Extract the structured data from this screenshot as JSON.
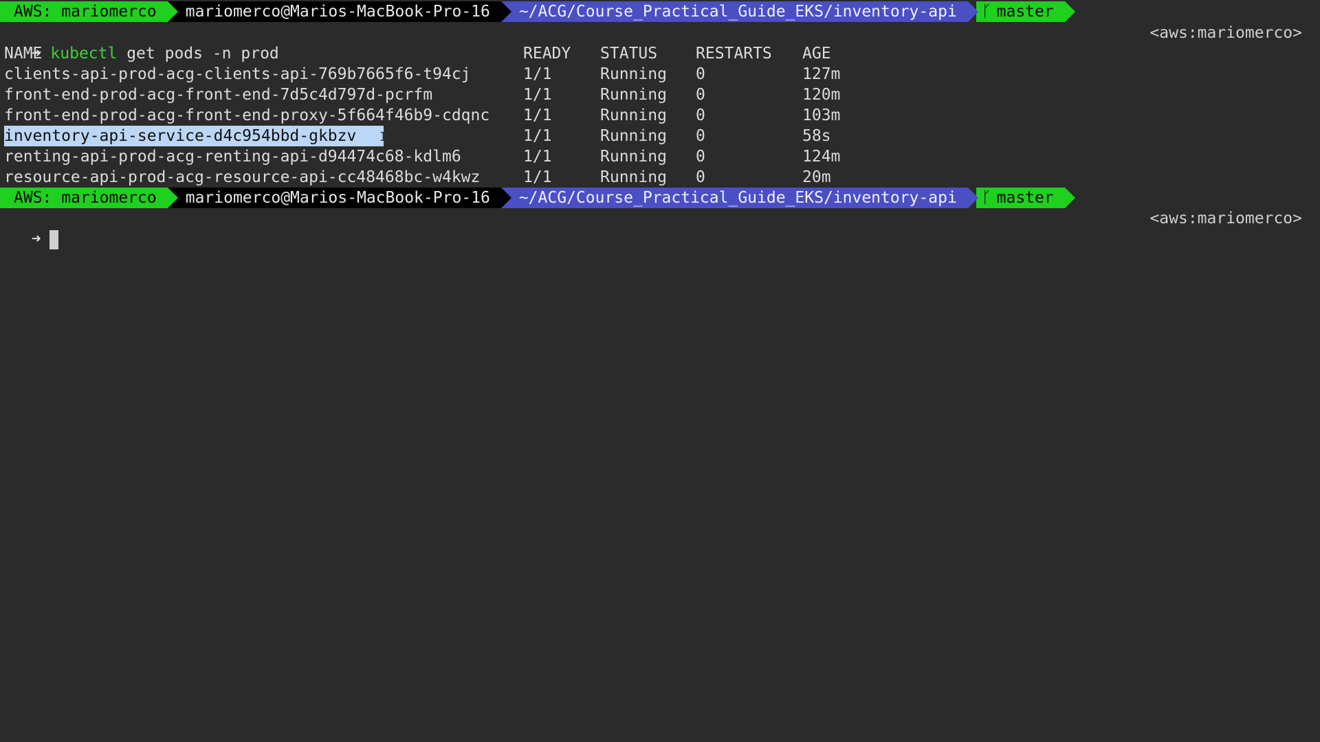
{
  "prompt": {
    "aws": "AWS: mariomerco",
    "host": "mariomerco@Marios-MacBook-Pro-16",
    "path": "~/ACG/Course_Practical_Guide_EKS/inventory-api",
    "branch_icon": "git-branch-icon",
    "branch": "master",
    "context": "<aws:mariomerco>",
    "arrow": "➜"
  },
  "command": {
    "program": "kubectl",
    "args": " get pods -n prod"
  },
  "table": {
    "headers": [
      "NAME",
      "READY",
      "STATUS",
      "RESTARTS",
      "AGE"
    ],
    "rows": [
      [
        "clients-api-prod-acg-clients-api-769b7665f6-t94cj",
        "1/1",
        "Running",
        "0",
        "127m"
      ],
      [
        "front-end-prod-acg-front-end-7d5c4d797d-pcrfm",
        "1/1",
        "Running",
        "0",
        "120m"
      ],
      [
        "front-end-prod-acg-front-end-proxy-5f664f46b9-cdqnc",
        "1/1",
        "Running",
        "0",
        "103m"
      ],
      [
        "inventory-api-service-d4c954bbd-gkbzv",
        "1/1",
        "Running",
        "0",
        "58s"
      ],
      [
        "renting-api-prod-acg-renting-api-d94474c68-kdlm6",
        "1/1",
        "Running",
        "0",
        "124m"
      ],
      [
        "resource-api-prod-acg-resource-api-cc48468bc-w4kwz",
        "1/1",
        "Running",
        "0",
        "20m"
      ]
    ],
    "selected_row": 3
  },
  "colors": {
    "background": "#2b2b2b",
    "aws_segment": "#1fd01f",
    "host_segment": "#000000",
    "path_segment": "#4a4fc4",
    "selection": "#bcd6f5"
  }
}
